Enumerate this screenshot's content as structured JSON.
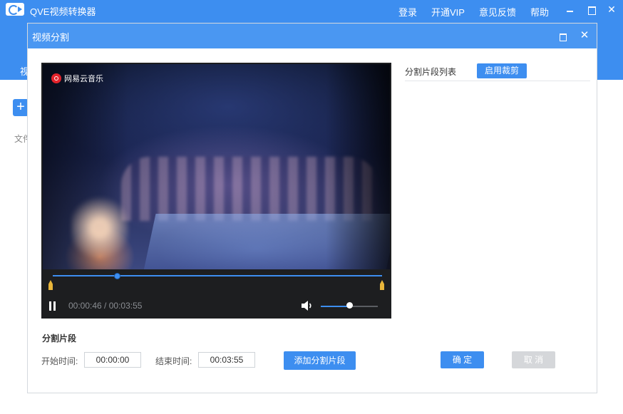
{
  "app": {
    "title": "QVE视频转换器",
    "menu": [
      "登录",
      "开通VIP",
      "意见反馈",
      "帮助"
    ],
    "close_glyph": "✕",
    "tab_peek": "视",
    "add_glyph": "+",
    "text_peek": "文件"
  },
  "dialog": {
    "title": "视频分割",
    "close_glyph": "✕",
    "player": {
      "watermark": "网易云音乐",
      "current_time": "00:00:46",
      "total_time": "00:03:55",
      "time_separator": " / ",
      "progress": 0.196,
      "volume": 0.5
    },
    "segment_list": {
      "label": "分割片段列表",
      "enable_crop": "启用裁剪"
    },
    "segment": {
      "heading": "分割片段",
      "start_label": "开始时间:",
      "start_value": "00:00:00",
      "end_label": "结束时间:",
      "end_value": "00:03:55",
      "add_button": "添加分割片段",
      "confirm": "确 定",
      "cancel": "取 消"
    }
  },
  "colors": {
    "accent": "#3d8ef0",
    "marker": "#e9b63a",
    "disabled": "#d5d7da"
  }
}
